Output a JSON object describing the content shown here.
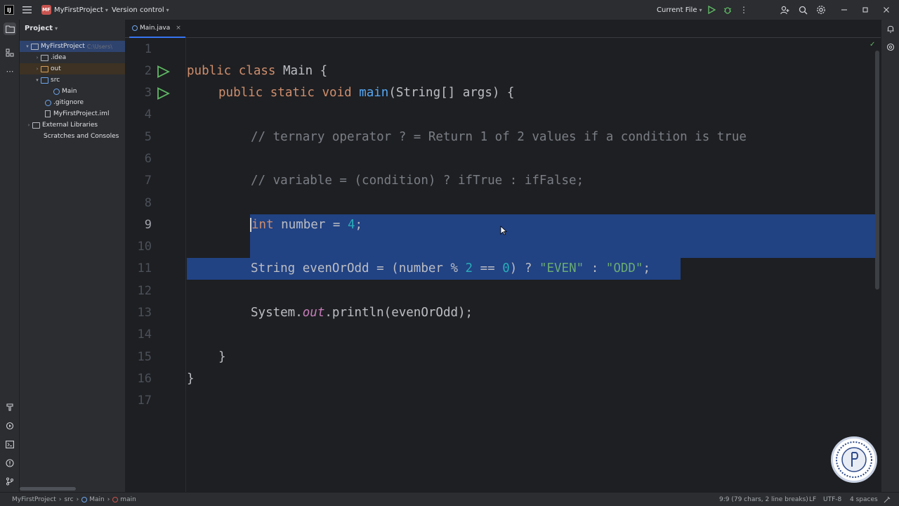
{
  "titlebar": {
    "app_logo": "IJ",
    "project_badge": "MF",
    "project_name": "MyFirstProject",
    "version_control": "Version control",
    "run_config": "Current File"
  },
  "project_panel": {
    "title": "Project",
    "root_label": "MyFirstProject",
    "root_path": "C:\\Users\\",
    "items": [
      {
        "label": ".idea"
      },
      {
        "label": "out"
      },
      {
        "label": "src"
      },
      {
        "label": "Main"
      },
      {
        "label": ".gitignore"
      },
      {
        "label": "MyFirstProject.iml"
      },
      {
        "label": "External Libraries"
      },
      {
        "label": "Scratches and Consoles"
      }
    ]
  },
  "tab": {
    "label": "Main.java"
  },
  "editor": {
    "line_numbers": [
      "1",
      "2",
      "3",
      "4",
      "5",
      "6",
      "7",
      "8",
      "9",
      "10",
      "11",
      "12",
      "13",
      "14",
      "15",
      "16",
      "17"
    ],
    "current_line": "9",
    "code": {
      "l2_kw": "public class",
      "l2_rest": " Main {",
      "l3_kw": "public static void",
      "l3_fn": "main",
      "l3_rest": "(String[] args) {",
      "l5": "// ternary operator ? = Return 1 of 2 values if a condition is true",
      "l7": "// variable = (condition) ? ifTrue : ifFalse;",
      "l9_kw": "int",
      "l9_a": " number = ",
      "l9_num": "4",
      "l9_b": ";",
      "l11_a": "String evenOrOdd = (number % ",
      "l11_n2": "2",
      "l11_b": " == ",
      "l11_n0": "0",
      "l11_c": ") ? ",
      "l11_s1": "\"EVEN\"",
      "l11_d": " : ",
      "l11_s2": "\"ODD\"",
      "l11_e": ";",
      "l13_a": "System.",
      "l13_fld": "out",
      "l13_b": ".println(evenOrOdd);",
      "l15": "}",
      "l16": "}"
    }
  },
  "statusbar": {
    "breadcrumb": [
      "MyFirstProject",
      "src",
      "Main",
      "main"
    ],
    "position": "9:9 (79 chars, 2 line breaks)",
    "line_ending": "LF",
    "encoding": "UTF-8",
    "indent": "4 spaces"
  },
  "colors": {
    "selection": "#214283",
    "keyword": "#cf8e6d",
    "function": "#56a8f5",
    "comment": "#7a7e85",
    "number": "#2aacb8",
    "string": "#6aab73"
  }
}
